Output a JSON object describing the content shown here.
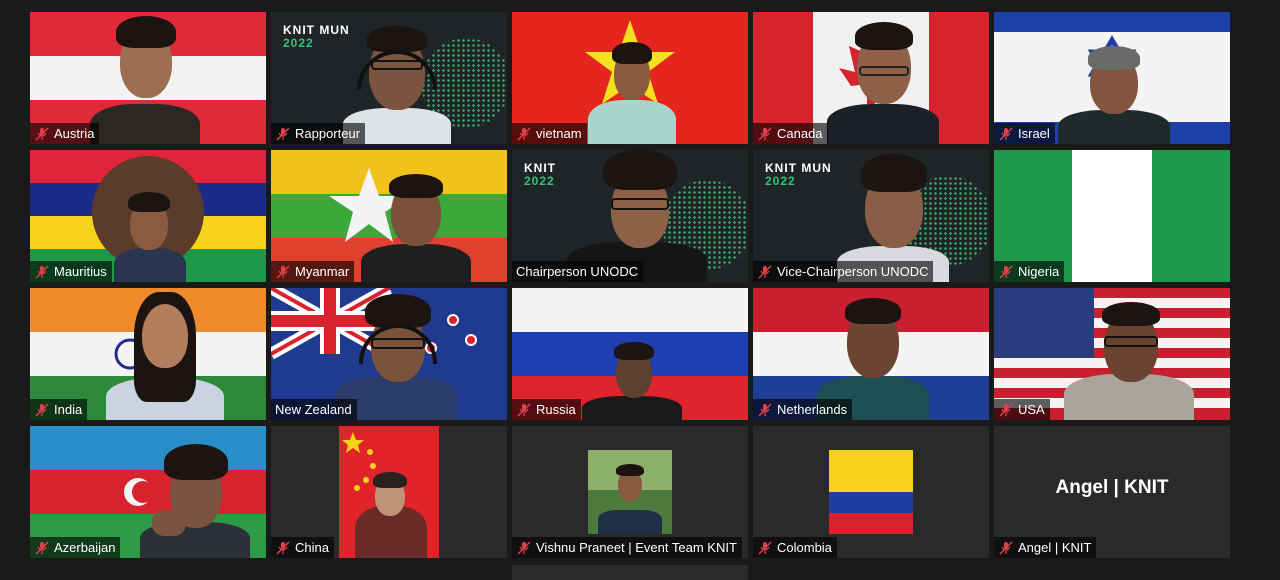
{
  "meeting": {
    "participants": [
      {
        "name": "Austria"
      },
      {
        "name": "Rapporteur",
        "header": "KNIT MUN",
        "year": "2022"
      },
      {
        "name": "vietnam"
      },
      {
        "name": "Canada"
      },
      {
        "name": "Israel"
      },
      {
        "name": "Mauritius"
      },
      {
        "name": "Myanmar"
      },
      {
        "name": "Chairperson UNODC",
        "header": "KNIT",
        "year": "2022"
      },
      {
        "name": "Vice-Chairperson UNODC",
        "header": "KNIT MUN",
        "year": "2022"
      },
      {
        "name": "Nigeria"
      },
      {
        "name": "India"
      },
      {
        "name": "New Zealand",
        "speaking": true
      },
      {
        "name": "Russia"
      },
      {
        "name": "Netherlands"
      },
      {
        "name": "USA"
      },
      {
        "name": "Azerbaijan"
      },
      {
        "name": "China"
      },
      {
        "name": "Vishnu Praneet | Event Team KNIT"
      },
      {
        "name": "Colombia"
      },
      {
        "name": "Angel | KNIT",
        "placeholder_name": "Angel | KNIT"
      }
    ]
  },
  "colors": {
    "tile_bg": "#2a2a2a",
    "speaking_border": "#e8e07a",
    "muted_icon": "#e0404a",
    "knit_green": "#39c07a"
  },
  "icons": {
    "muted": "mic-off-icon"
  }
}
